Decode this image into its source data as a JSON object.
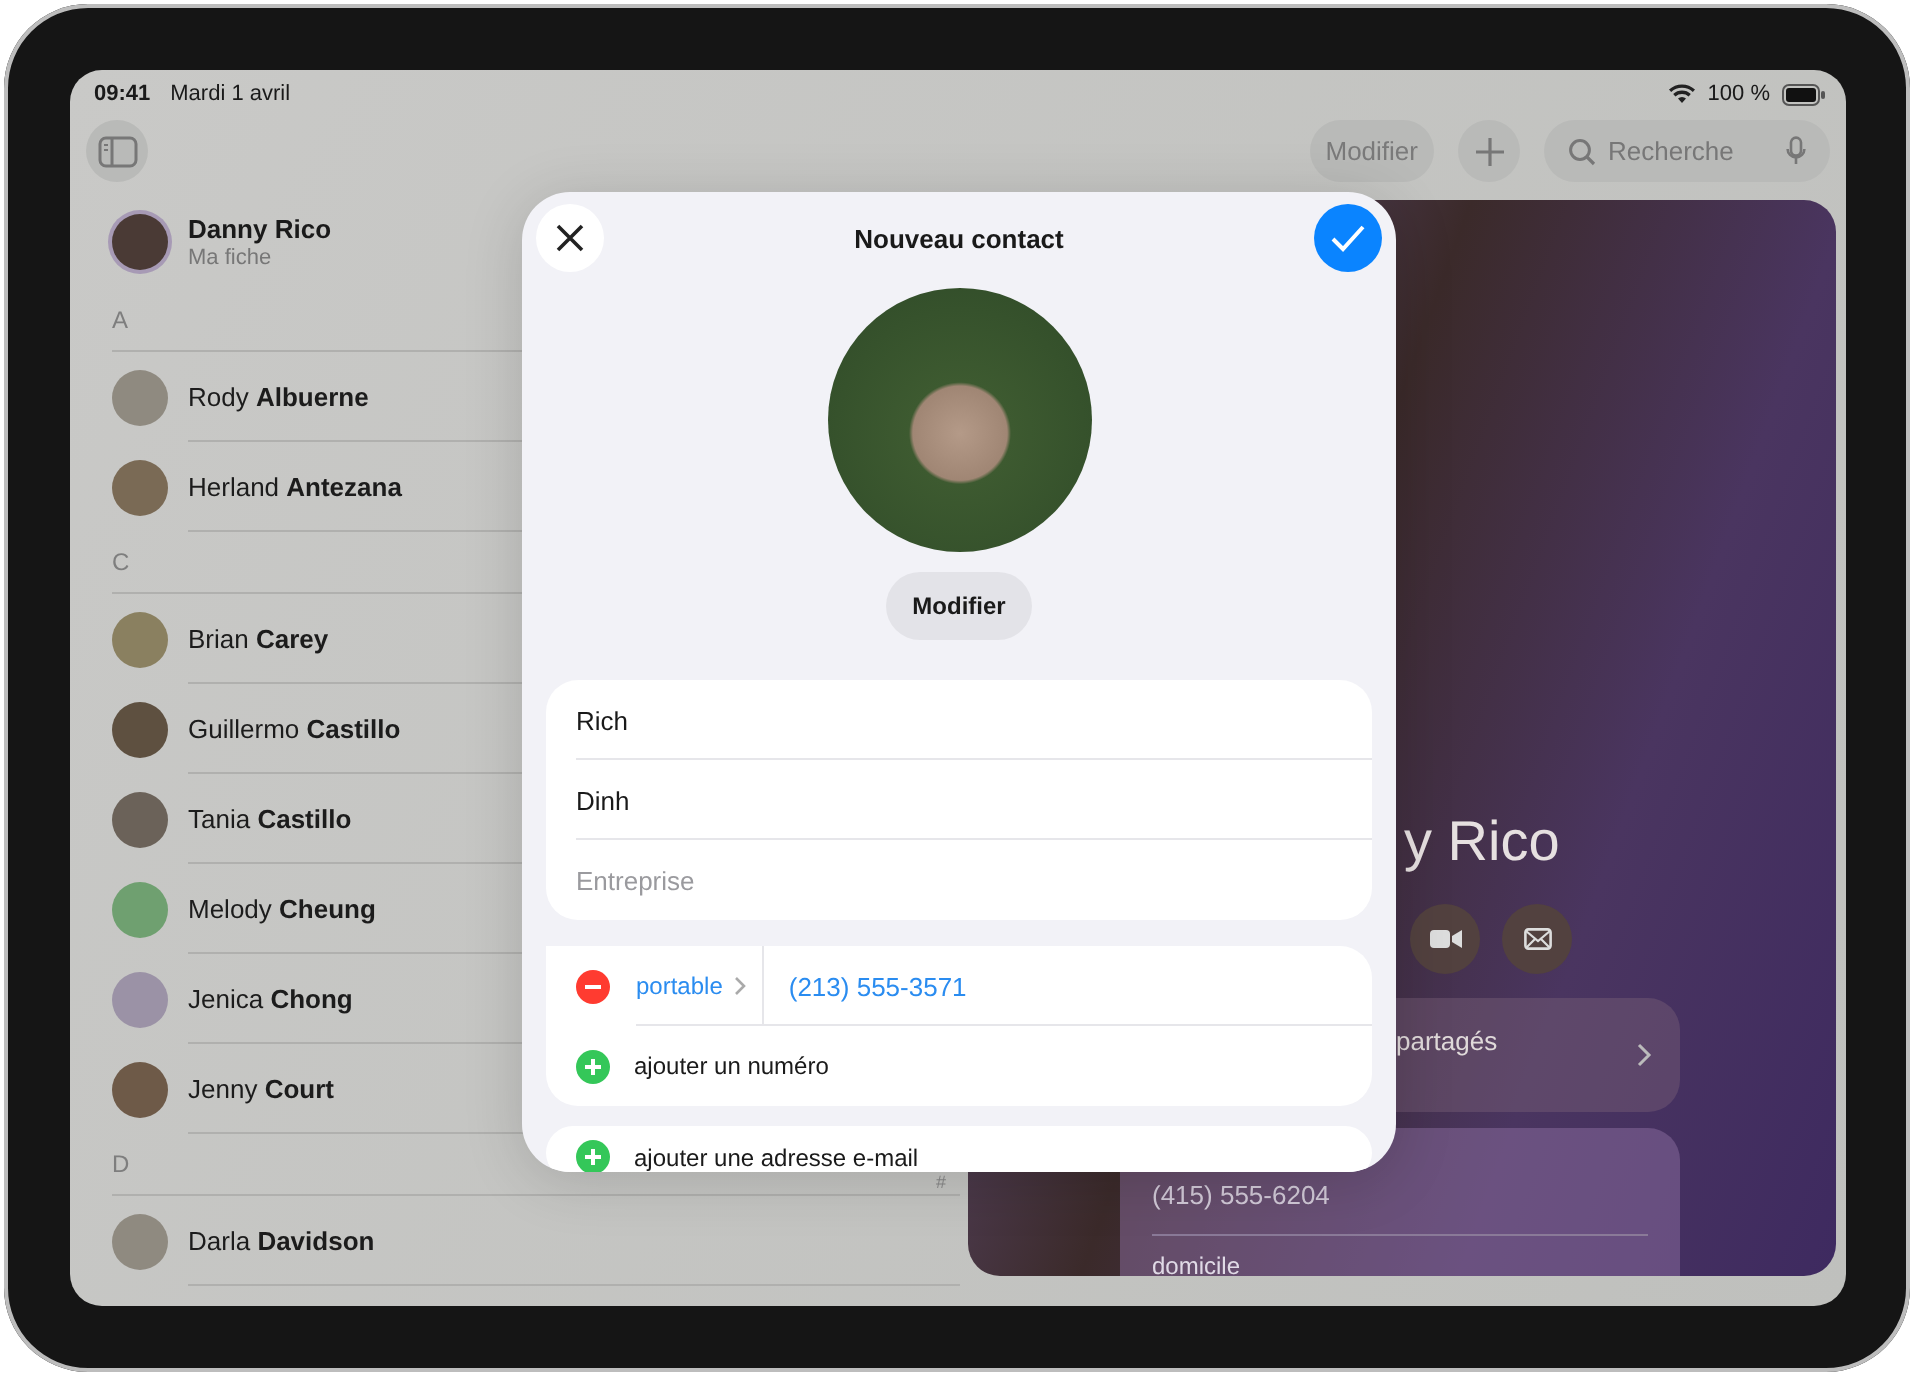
{
  "status_bar": {
    "time": "09:41",
    "date": "Mardi 1 avril",
    "battery": "100 %"
  },
  "toolbar": {
    "edit_button": "Modifier",
    "search": {
      "placeholder": "Recherche"
    }
  },
  "my_card": {
    "name": "Danny Rico",
    "subtitle": "Ma fiche"
  },
  "contact_sections": [
    {
      "letter": "A",
      "contacts": [
        "Rody **Albuerne**",
        "Herland **Antezana**"
      ]
    },
    {
      "letter": "C",
      "contacts": [
        "Brian **Carey**",
        "Guillermo **Castillo**",
        "Tania **Castillo**",
        "Melody **Cheung**",
        "Jenica **Chong**",
        "Jenny **Court**"
      ]
    },
    {
      "letter": "D",
      "contacts": [
        "Darla **Davidson**"
      ]
    }
  ],
  "index_letters": [
    "#"
  ],
  "detail": {
    "name": "y Rico",
    "shared_label": "partagés",
    "phone": "(415) 555-6204",
    "next_label": "domicile"
  },
  "new_contact_sheet": {
    "title": "Nouveau contact",
    "edit_photo_button": "Modifier",
    "fields": [
      {
        "value": "Rich"
      },
      {
        "value": "Dinh"
      },
      {
        "placeholder": "Entreprise"
      }
    ],
    "phones": [
      {
        "label": "portable",
        "number": "(213) 555-3571"
      }
    ],
    "add_phone": "ajouter un numéro",
    "add_email": "ajouter une adresse e-mail"
  }
}
